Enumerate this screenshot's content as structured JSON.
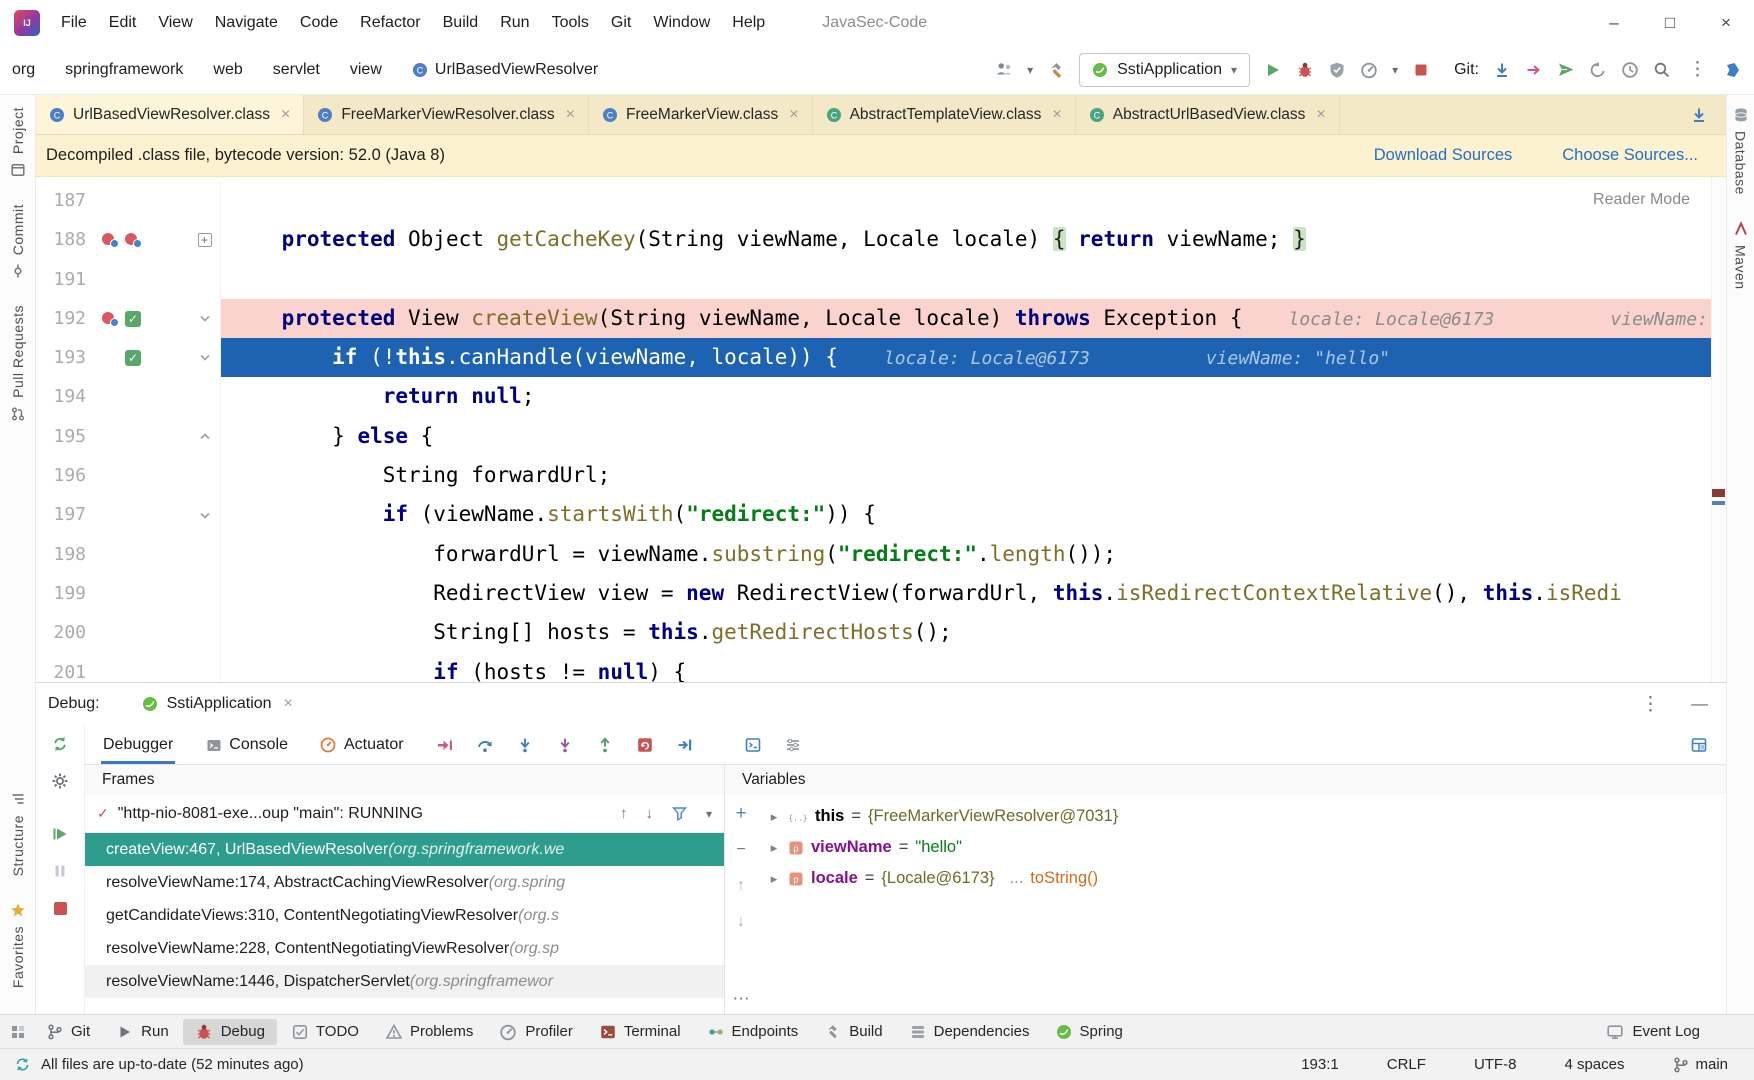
{
  "titlebar": {
    "title": "JavaSec-Code",
    "menus": [
      "File",
      "Edit",
      "View",
      "Navigate",
      "Code",
      "Refactor",
      "Build",
      "Run",
      "Tools",
      "Git",
      "Window",
      "Help"
    ]
  },
  "ui": {
    "minimize": "–",
    "maximize": "□",
    "close": "×",
    "caret": "▾",
    "more": "⋮",
    "ellipsis": "⋯",
    "plus": "+",
    "minus": "−",
    "up": "↑",
    "down": "↓",
    "check": "✓",
    "dash": "—",
    "chev": "▸",
    "logo": "IJ",
    "star": "★"
  },
  "toolbar": {
    "breadcrumbs": [
      "org",
      "springframework",
      "web",
      "servlet",
      "view"
    ],
    "class_crumb": "UrlBasedViewResolver",
    "run_config": "SstiApplication",
    "git_label": "Git:"
  },
  "tabs": [
    {
      "label": "UrlBasedViewResolver.class",
      "active": true,
      "icon": "classBlue"
    },
    {
      "label": "FreeMarkerViewResolver.class",
      "active": false,
      "icon": "classBlue"
    },
    {
      "label": "FreeMarkerView.class",
      "active": false,
      "icon": "classBlue"
    },
    {
      "label": "AbstractTemplateView.class",
      "active": false,
      "icon": "classGreen"
    },
    {
      "label": "AbstractUrlBasedView.class",
      "active": false,
      "icon": "classGreen"
    }
  ],
  "notification": {
    "message": "Decompiled .class file, bytecode version: 52.0 (Java 8)",
    "link1": "Download Sources",
    "link2": "Choose Sources..."
  },
  "editor": {
    "reader_mode": "Reader Mode",
    "lines": [
      {
        "num": "187",
        "bg": "",
        "fold": "",
        "gutter": [],
        "segs": []
      },
      {
        "num": "188",
        "bg": "",
        "fold": "plus",
        "gutter": [
          "bp",
          "bp"
        ],
        "segs": [
          [
            "p",
            "    "
          ],
          [
            "k",
            "protected"
          ],
          [
            "p",
            " Object "
          ],
          [
            "m",
            "getCacheKey"
          ],
          [
            "p",
            "(String viewName, Locale locale) "
          ],
          [
            "b",
            "{"
          ],
          [
            "p",
            " "
          ],
          [
            "k",
            "return"
          ],
          [
            "p",
            " viewName; "
          ],
          [
            "b",
            "}"
          ]
        ]
      },
      {
        "num": "191",
        "bg": "",
        "fold": "",
        "gutter": [],
        "segs": []
      },
      {
        "num": "192",
        "bg": "pink",
        "fold": "down",
        "gutter": [
          "bp",
          "check"
        ],
        "segs": [
          [
            "p",
            "    "
          ],
          [
            "k",
            "protected"
          ],
          [
            "p",
            " View "
          ],
          [
            "m",
            "createView"
          ],
          [
            "p",
            "(String viewName, Locale locale) "
          ],
          [
            "k",
            "throws"
          ],
          [
            "p",
            " Exception {"
          ],
          [
            "h",
            "locale: Locale@6173"
          ],
          [
            "h",
            "viewName: \"hello\""
          ]
        ]
      },
      {
        "num": "193",
        "bg": "blue",
        "fold": "down",
        "gutter": [
          "sp",
          "check"
        ],
        "segs": [
          [
            "p",
            "        "
          ],
          [
            "k",
            "if"
          ],
          [
            "p",
            " (!"
          ],
          [
            "k",
            "this"
          ],
          [
            "p",
            "."
          ],
          [
            "m",
            "canHandle"
          ],
          [
            "p",
            "(viewName, locale)) {"
          ],
          [
            "h",
            "locale: Locale@6173"
          ],
          [
            "h",
            "viewName: \"hello\""
          ]
        ]
      },
      {
        "num": "194",
        "bg": "",
        "fold": "",
        "gutter": [],
        "segs": [
          [
            "p",
            "            "
          ],
          [
            "k",
            "return"
          ],
          [
            "p",
            " "
          ],
          [
            "k",
            "null"
          ],
          [
            "p",
            ";"
          ]
        ]
      },
      {
        "num": "195",
        "bg": "",
        "fold": "up",
        "gutter": [],
        "segs": [
          [
            "p",
            "        } "
          ],
          [
            "k",
            "else"
          ],
          [
            "p",
            " {"
          ]
        ]
      },
      {
        "num": "196",
        "bg": "",
        "fold": "",
        "gutter": [],
        "segs": [
          [
            "p",
            "            String forwardUrl;"
          ]
        ]
      },
      {
        "num": "197",
        "bg": "",
        "fold": "down",
        "gutter": [],
        "segs": [
          [
            "p",
            "            "
          ],
          [
            "k",
            "if"
          ],
          [
            "p",
            " (viewName."
          ],
          [
            "m",
            "startsWith"
          ],
          [
            "p",
            "("
          ],
          [
            "s",
            "\"redirect:\""
          ],
          [
            "p",
            ")) {"
          ]
        ]
      },
      {
        "num": "198",
        "bg": "",
        "fold": "",
        "gutter": [],
        "segs": [
          [
            "p",
            "                forwardUrl = viewName."
          ],
          [
            "m",
            "substring"
          ],
          [
            "p",
            "("
          ],
          [
            "s",
            "\"redirect:\""
          ],
          [
            "p",
            "."
          ],
          [
            "m",
            "length"
          ],
          [
            "p",
            "());"
          ]
        ]
      },
      {
        "num": "199",
        "bg": "",
        "fold": "",
        "gutter": [],
        "segs": [
          [
            "p",
            "                RedirectView view = "
          ],
          [
            "k",
            "new"
          ],
          [
            "p",
            " RedirectView(forwardUrl, "
          ],
          [
            "k",
            "this"
          ],
          [
            "p",
            "."
          ],
          [
            "m",
            "isRedirectContextRelative"
          ],
          [
            "p",
            "(), "
          ],
          [
            "k",
            "this"
          ],
          [
            "p",
            "."
          ],
          [
            "m",
            "isRedi"
          ]
        ]
      },
      {
        "num": "200",
        "bg": "",
        "fold": "",
        "gutter": [],
        "segs": [
          [
            "p",
            "                String[] hosts = "
          ],
          [
            "k",
            "this"
          ],
          [
            "p",
            "."
          ],
          [
            "m",
            "getRedirectHosts"
          ],
          [
            "p",
            "();"
          ]
        ]
      },
      {
        "num": "201",
        "bg": "",
        "fold": "",
        "gutter": [],
        "segs": [
          [
            "p",
            "                "
          ],
          [
            "k",
            "if"
          ],
          [
            "p",
            " (hosts != "
          ],
          [
            "k",
            "null"
          ],
          [
            "p",
            ") {"
          ]
        ]
      }
    ]
  },
  "debug": {
    "label": "Debug:",
    "session": "SstiApplication",
    "tabs": [
      {
        "label": "Debugger",
        "active": true,
        "icon": ""
      },
      {
        "label": "Console",
        "active": false,
        "icon": "consoleTab"
      },
      {
        "label": "Actuator",
        "active": false,
        "icon": "actuator"
      }
    ],
    "actions": [
      "show-execution-point",
      "step-over",
      "step-into",
      "force-step-into",
      "step-out",
      "reset-frame",
      "run-to-cursor",
      "evaluate-expression",
      "settings-list"
    ],
    "frames_header": "Frames",
    "thread": "\"http-nio-8081-exe...oup \"main\": RUNNING",
    "frames": [
      {
        "text": "createView:467, UrlBasedViewResolver ",
        "loc": "(org.springframework.we",
        "selected": true
      },
      {
        "text": "resolveViewName:174, AbstractCachingViewResolver ",
        "loc": "(org.spring",
        "selected": false
      },
      {
        "text": "getCandidateViews:310, ContentNegotiatingViewResolver ",
        "loc": "(org.s",
        "selected": false
      },
      {
        "text": "resolveViewName:228, ContentNegotiatingViewResolver ",
        "loc": "(org.sp",
        "selected": false
      },
      {
        "text": "resolveViewName:1446, DispatcherServlet ",
        "loc": "(org.springframewor",
        "selected": false
      }
    ],
    "variables_header": "Variables",
    "variables": [
      {
        "icon": "this",
        "name": "this",
        "value": "{FreeMarkerViewResolver@7031}",
        "vtype": "obj",
        "extra": ""
      },
      {
        "icon": "param",
        "name": "viewName",
        "value": "\"hello\"",
        "vtype": "str",
        "extra": ""
      },
      {
        "icon": "param",
        "name": "locale",
        "value": "{Locale@6173}",
        "vtype": "obj",
        "extra": "... toString()"
      }
    ]
  },
  "statusbar": {
    "tools": [
      {
        "label": "Git",
        "icon": "branch",
        "active": false
      },
      {
        "label": "Run",
        "icon": "runGray",
        "active": false
      },
      {
        "label": "Debug",
        "icon": "bug",
        "active": true
      },
      {
        "label": "TODO",
        "icon": "todo",
        "active": false
      },
      {
        "label": "Problems",
        "icon": "problems",
        "active": false
      },
      {
        "label": "Profiler",
        "icon": "profiler",
        "active": false
      },
      {
        "label": "Terminal",
        "icon": "terminal",
        "active": false
      },
      {
        "label": "Endpoints",
        "icon": "endpoints",
        "active": false
      },
      {
        "label": "Build",
        "icon": "buildGray",
        "active": false
      },
      {
        "label": "Dependencies",
        "icon": "deps",
        "active": false
      },
      {
        "label": "Spring",
        "icon": "leaf",
        "active": false
      }
    ],
    "event_log": "Event Log",
    "sync_message": "All files are up-to-date (52 minutes ago)",
    "caret": "193:1",
    "line_ending": "CRLF",
    "encoding": "UTF-8",
    "indent": "4 spaces",
    "branch": "main"
  },
  "left_strip": {
    "top": [
      {
        "label": "Project",
        "icon": "projectIcon"
      },
      {
        "label": "Commit",
        "icon": "commitIcon"
      },
      {
        "label": "Pull Requests",
        "icon": "prIcon"
      }
    ],
    "bottom": [
      {
        "label": "Structure",
        "icon": "structureIcon"
      },
      {
        "label": "Favorites",
        "icon": "favStar"
      }
    ]
  },
  "right_strip": [
    {
      "label": "Database",
      "icon": "dbIcon"
    },
    {
      "label": "Maven",
      "icon": "mavenIcon"
    }
  ]
}
